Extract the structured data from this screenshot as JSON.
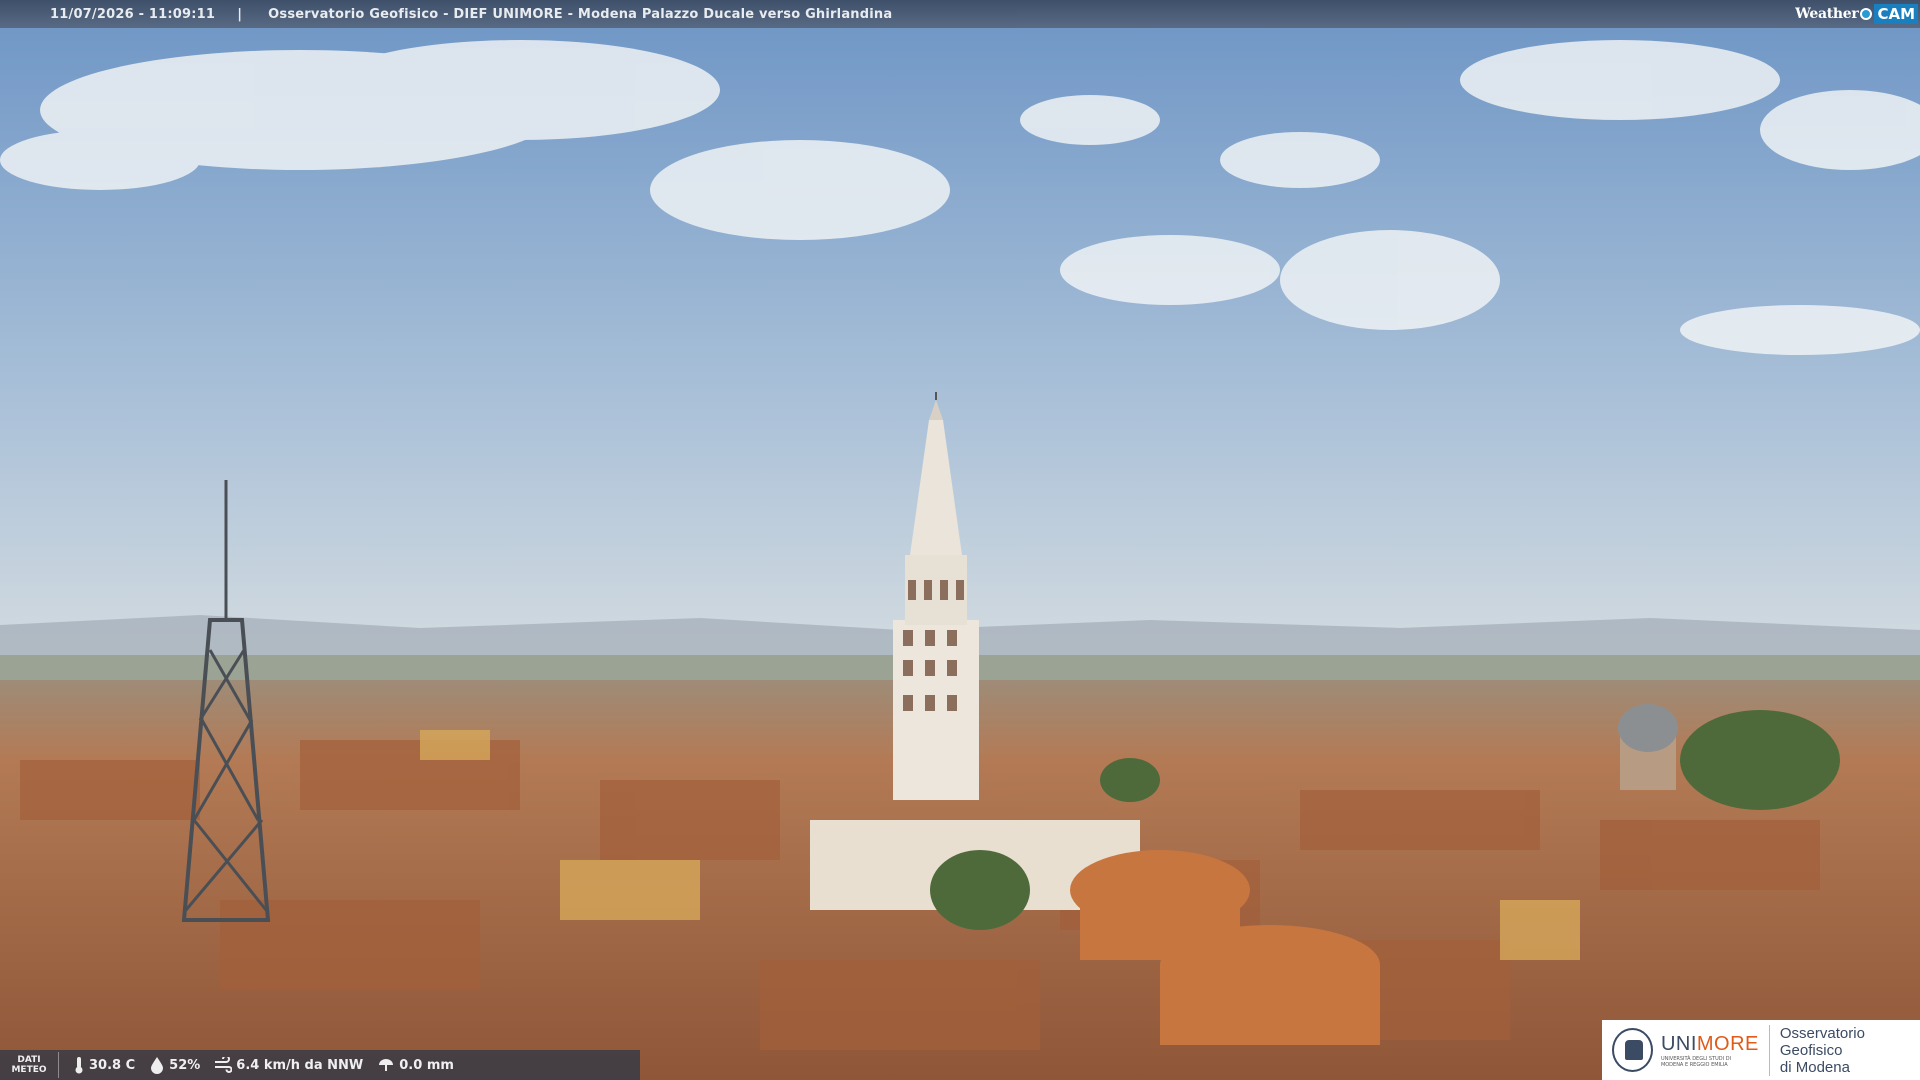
{
  "header": {
    "timestamp": "11/07/2026 - 11:09:11",
    "separator": "|",
    "title": "Osservatorio Geofisico - DIEF UNIMORE - Modena Palazzo Ducale verso Ghirlandina",
    "brand_weather": "Weather",
    "brand_cam": "CAM"
  },
  "weather": {
    "label_line1": "DATI",
    "label_line2": "METEO",
    "temperature": "30.8 C",
    "humidity": "52%",
    "wind": "6.4 km/h da NNW",
    "rain": "0.0 mm",
    "icons": [
      "thermometer-icon",
      "humidity-drop-icon",
      "wind-icon",
      "rain-icon"
    ]
  },
  "logo": {
    "uni_prefix": "UNI",
    "uni_suffix": "MORE",
    "uni_subtitle": "UNIVERSITÀ DEGLI STUDI DI MODENA E REGGIO EMILIA",
    "observatory_line1": "Osservatorio Geofisico",
    "observatory_line2": "di Modena"
  },
  "colors": {
    "sky_top": "#6f97c6",
    "sky_bottom": "#c9d6e2",
    "roofs": "#b56a42",
    "tower": "#ece6dc",
    "accent": "#e05a1a"
  }
}
